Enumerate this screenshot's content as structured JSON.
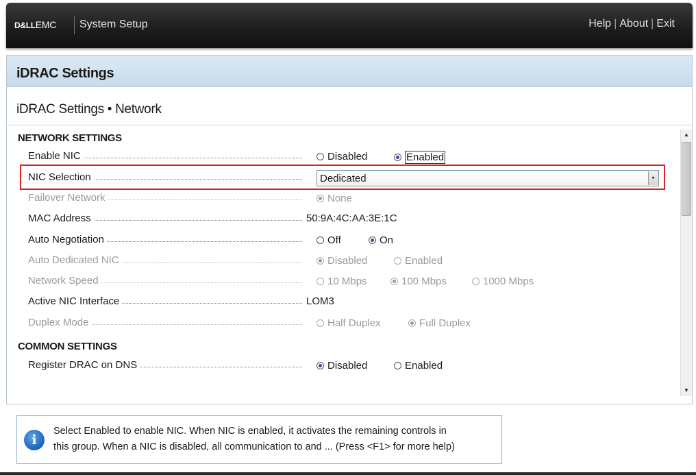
{
  "topbar": {
    "brand_bold": "D&LL",
    "brand_rest": "EMC",
    "title": "System Setup",
    "links": [
      "Help",
      "About",
      "Exit"
    ]
  },
  "panel": {
    "header": "iDRAC Settings",
    "subtitle": "iDRAC Settings • Network"
  },
  "network_settings": {
    "heading": "NETWORK SETTINGS",
    "enable_nic": {
      "label": "Enable NIC",
      "options": [
        "Disabled",
        "Enabled"
      ],
      "selected": "Enabled"
    },
    "nic_selection": {
      "label": "NIC Selection",
      "value": "Dedicated"
    },
    "failover_network": {
      "label": "Failover Network",
      "options": [
        "None"
      ],
      "selected": "None"
    },
    "mac_address": {
      "label": "MAC Address",
      "value": "50:9A:4C:AA:3E:1C"
    },
    "auto_negotiation": {
      "label": "Auto Negotiation",
      "options": [
        "Off",
        "On"
      ],
      "selected": "On"
    },
    "auto_dedicated_nic": {
      "label": "Auto Dedicated NIC",
      "options": [
        "Disabled",
        "Enabled"
      ],
      "selected": "Disabled"
    },
    "network_speed": {
      "label": "Network Speed",
      "options": [
        "10 Mbps",
        "100 Mbps",
        "1000 Mbps"
      ],
      "selected": "100 Mbps"
    },
    "active_nic_interface": {
      "label": "Active NIC Interface",
      "value": "LOM3"
    },
    "duplex_mode": {
      "label": "Duplex Mode",
      "options": [
        "Half Duplex",
        "Full Duplex"
      ],
      "selected": "Full Duplex"
    }
  },
  "common_settings": {
    "heading": "COMMON SETTINGS",
    "register_drac_dns": {
      "label": "Register DRAC on DNS",
      "options": [
        "Disabled",
        "Enabled"
      ],
      "selected": "Disabled"
    }
  },
  "help": {
    "icon": "info-icon",
    "text_line1": "Select Enabled to enable NIC. When NIC is enabled, it activates the remaining controls in",
    "text_line2": "this group. When a NIC is disabled, all communication to and ... (Press <F1> for more help)"
  },
  "colors": {
    "highlight": "#d8232a",
    "radio_selected": "#3a4b9a",
    "header_bg": "#c7dbeb"
  }
}
